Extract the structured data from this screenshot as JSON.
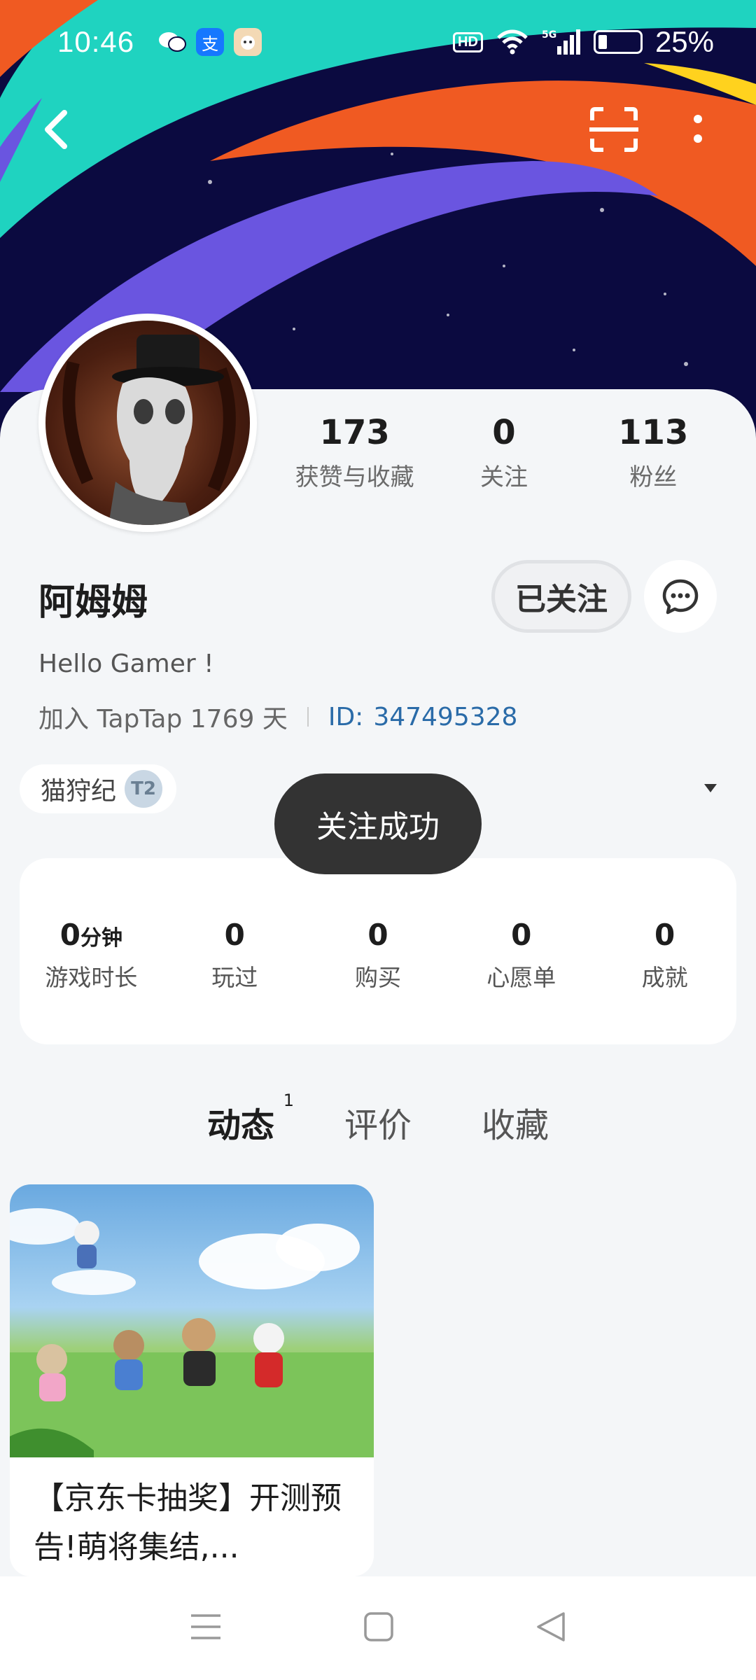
{
  "status_bar": {
    "time": "10:46",
    "apps": [
      "wechat-icon",
      "alipay-icon",
      "app-icon"
    ],
    "network": "5G",
    "battery": "25%"
  },
  "profile": {
    "username": "阿姆姆",
    "bio": "Hello Gamer !",
    "joined": "加入 TapTap 1769 天",
    "id_label": "ID:",
    "id_value": "347495328",
    "stats": [
      {
        "num": "173",
        "label": "获赞与收藏"
      },
      {
        "num": "0",
        "label": "关注"
      },
      {
        "num": "113",
        "label": "粉丝"
      }
    ],
    "follow_label": "已关注",
    "tag_label": "猫狩纪",
    "tag_badge": "T2"
  },
  "toast": "关注成功",
  "game_stats": [
    {
      "num": "0",
      "unit": "分钟",
      "label": "游戏时长"
    },
    {
      "num": "0",
      "unit": "",
      "label": "玩过"
    },
    {
      "num": "0",
      "unit": "",
      "label": "购买"
    },
    {
      "num": "0",
      "unit": "",
      "label": "心愿单"
    },
    {
      "num": "0",
      "unit": "",
      "label": "成就"
    }
  ],
  "tabs": [
    {
      "label": "动态",
      "sup": "1"
    },
    {
      "label": "评价",
      "sup": ""
    },
    {
      "label": "收藏",
      "sup": ""
    }
  ],
  "post": {
    "title": "【京东卡抽奖】开测预告!萌将集结,..."
  },
  "colors": {
    "accent": "#14c9c0",
    "id_link": "#2a6ba8",
    "toast_bg": "#333333"
  }
}
